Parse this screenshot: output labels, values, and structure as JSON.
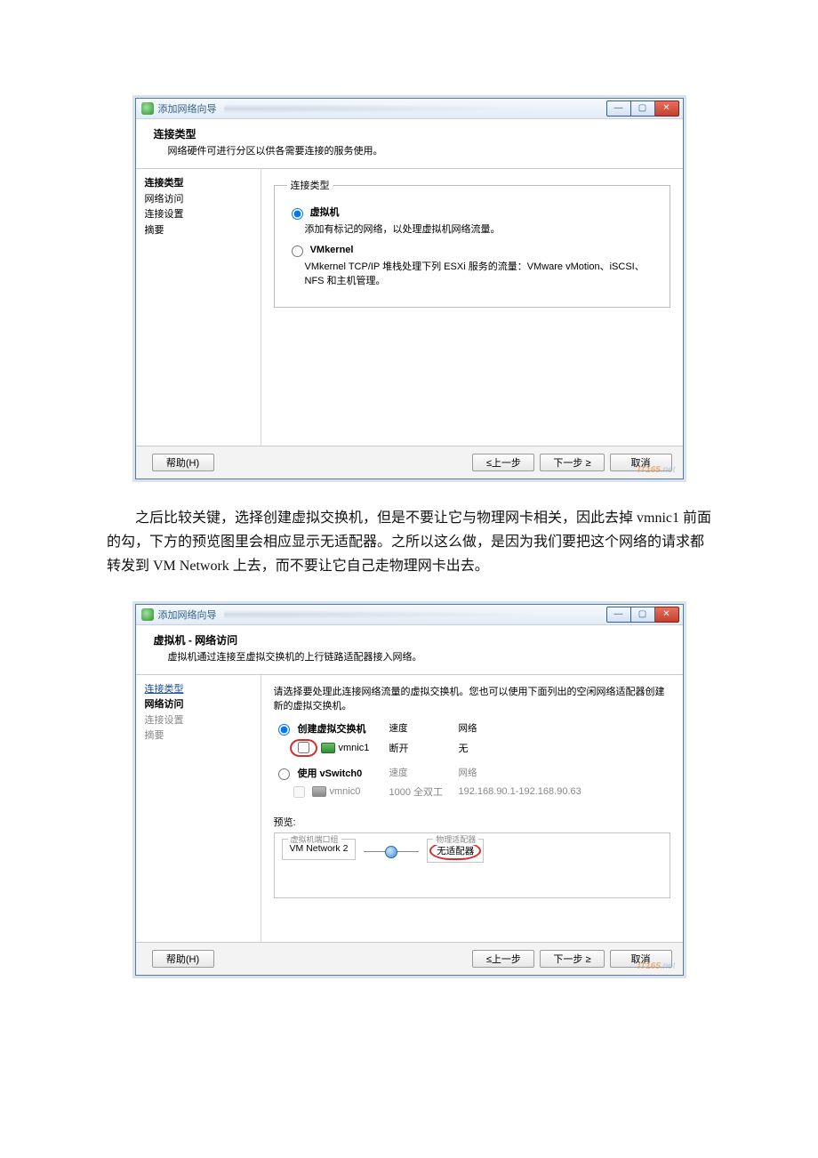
{
  "dialog1": {
    "title": "添加网络向导",
    "header": {
      "title": "连接类型",
      "subtitle": "网络硬件可进行分区以供各需要连接的服务使用。"
    },
    "sidebar": [
      "连接类型",
      "网络访问",
      "连接设置",
      "摘要"
    ],
    "group_legend": "连接类型",
    "opt_vm": {
      "label": "虚拟机",
      "desc": "添加有标记的网络，以处理虚拟机网络流量。"
    },
    "opt_vmk": {
      "label": "VMkernel",
      "desc": "VMkernel TCP/IP 堆栈处理下列 ESXi 服务的流量：VMware vMotion、iSCSI、NFS 和主机管理。"
    },
    "buttons": {
      "help": "帮助(H)",
      "back": "≤上一步",
      "next": "下一步 ≥",
      "cancel": "取消"
    }
  },
  "paragraph": "之后比较关键，选择创建虚拟交换机，但是不要让它与物理网卡相关，因此去掉 vmnic1 前面的勾，下方的预览图里会相应显示无适配器。之所以这么做，是因为我们要把这个网络的请求都转发到 VM Network 上去，而不要让它自己走物理网卡出去。",
  "dialog2": {
    "title": "添加网络向导",
    "header": {
      "title": "虚拟机 - 网络访问",
      "subtitle": "虚拟机通过连接至虚拟交换机的上行链路适配器接入网络。"
    },
    "sidebar": [
      "连接类型",
      "网络访问",
      "连接设置",
      "摘要"
    ],
    "instruction": "请选择要处理此连接网络流量的虚拟交换机。您也可以使用下面列出的空闲网络适配器创建新的虚拟交换机。",
    "cols": {
      "speed": "速度",
      "network": "网络"
    },
    "opt_create": {
      "label": "创建虚拟交换机",
      "nic": "vmnic1",
      "speed": "断开",
      "network": "无"
    },
    "opt_use": {
      "label": "使用 vSwitch0",
      "nic": "vmnic0",
      "speed": "1000 全双工",
      "network": "192.168.90.1-192.168.90.63"
    },
    "preview_label": "预览:",
    "preview": {
      "group_legend": "虚拟机端口组",
      "portgroup": "VM Network 2",
      "right_legend": "物理适配器",
      "right_text": "无适配器"
    },
    "buttons": {
      "help": "帮助(H)",
      "back": "≤上一步",
      "next": "下一步 ≥",
      "cancel": "取消"
    }
  },
  "watermark": {
    "brand": "IT165",
    "suffix": ".net"
  }
}
